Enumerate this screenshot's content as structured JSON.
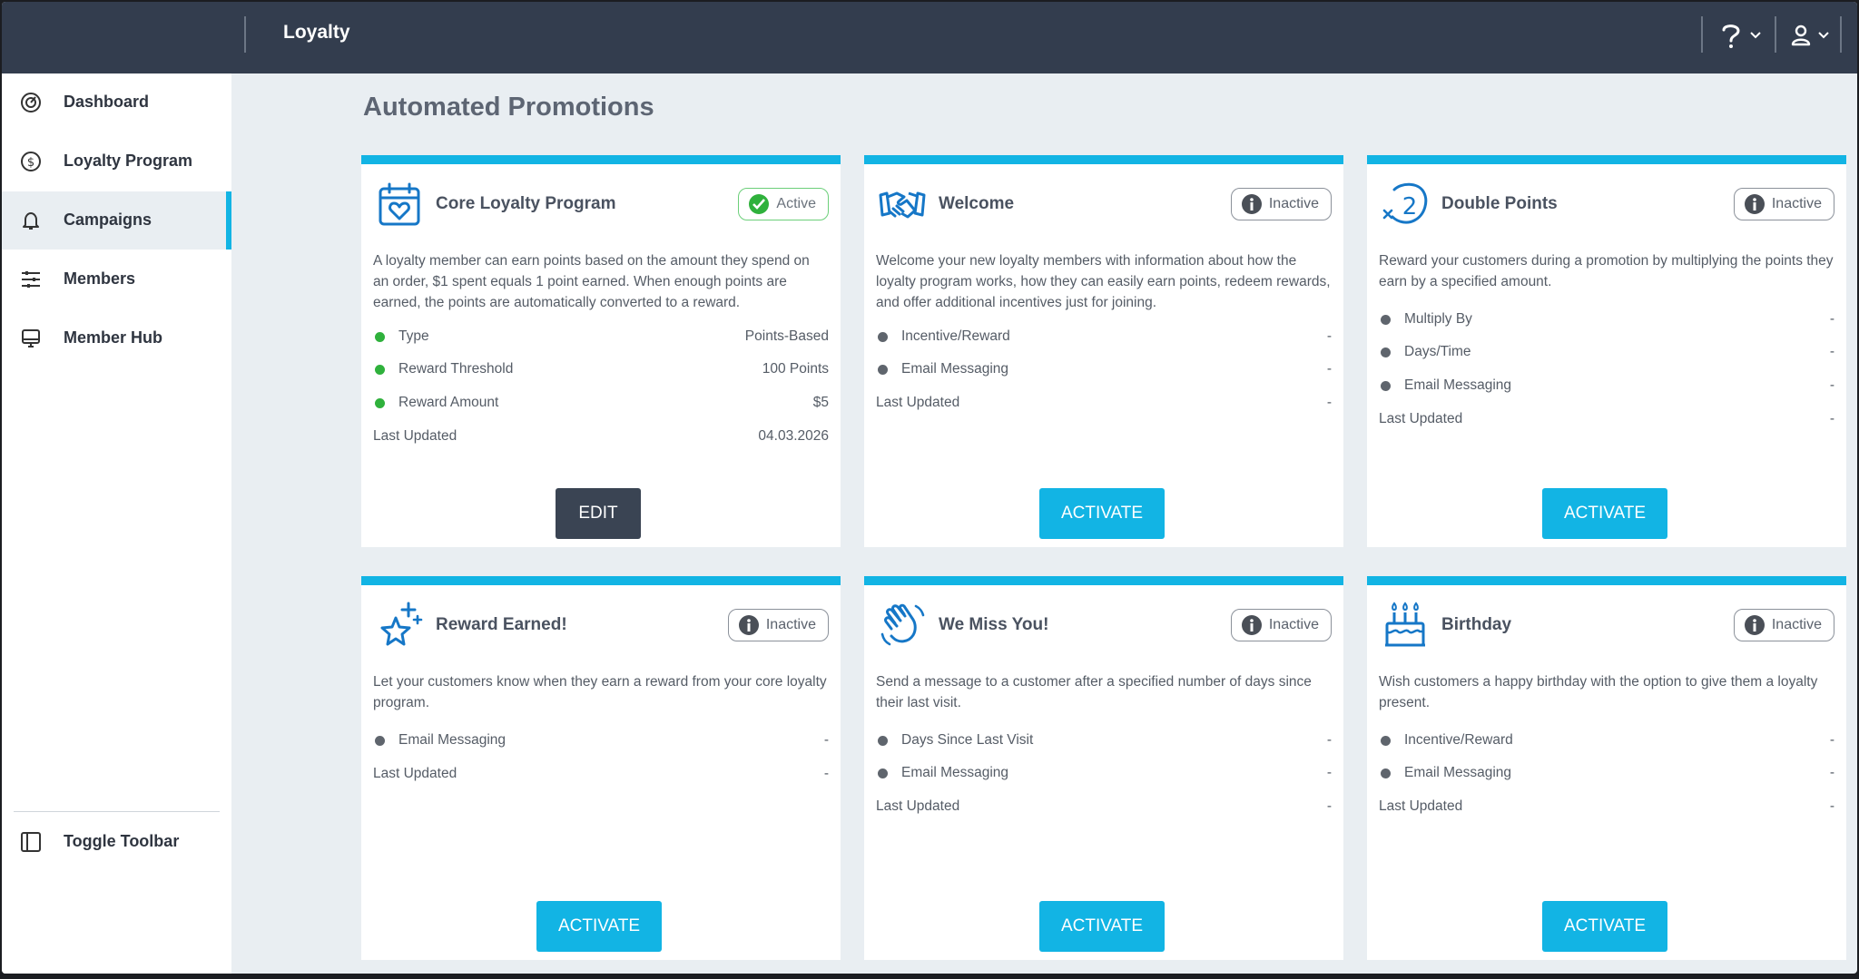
{
  "header": {
    "app_title": "Loyalty"
  },
  "sidebar": {
    "items": [
      {
        "label": "Dashboard",
        "icon": "dashboard-gauge-icon"
      },
      {
        "label": "Loyalty Program",
        "icon": "dollar-circle-icon"
      },
      {
        "label": "Campaigns",
        "icon": "bell-icon",
        "active": true
      },
      {
        "label": "Members",
        "icon": "sliders-icon"
      },
      {
        "label": "Member Hub",
        "icon": "monitor-icon"
      }
    ],
    "toggle_label": "Toggle Toolbar"
  },
  "main": {
    "title": "Automated Promotions",
    "cards": [
      {
        "title": "Core Loyalty Program",
        "icon": "calendar-heart-icon",
        "status": "Active",
        "description": "A loyalty member can earn points based on the amount they spend on an order, $1 spent equals 1 point earned. When enough points are earned, the points are automatically converted to a reward.",
        "rows": [
          {
            "label": "Type",
            "value": "Points-Based"
          },
          {
            "label": "Reward Threshold",
            "value": "100 Points"
          },
          {
            "label": "Reward Amount",
            "value": "$5"
          }
        ],
        "last_updated_label": "Last Updated",
        "last_updated": "04.03.2026",
        "button": "EDIT"
      },
      {
        "title": "Welcome",
        "icon": "handshake-icon",
        "status": "Inactive",
        "description": "Welcome your new loyalty members with information about how the loyalty program works, how they can easily earn points, redeem rewards, and offer additional incentives just for joining.",
        "rows": [
          {
            "label": "Incentive/Reward",
            "value": "-"
          },
          {
            "label": "Email Messaging",
            "value": "-"
          }
        ],
        "last_updated_label": "Last Updated",
        "last_updated": "-",
        "button": "ACTIVATE"
      },
      {
        "title": "Double Points",
        "icon": "times-two-icon",
        "status": "Inactive",
        "description": "Reward your customers during a promotion by multiplying the points they earn by a specified amount.",
        "rows": [
          {
            "label": "Multiply By",
            "value": "-"
          },
          {
            "label": "Days/Time",
            "value": "-"
          },
          {
            "label": "Email Messaging",
            "value": "-"
          }
        ],
        "last_updated_label": "Last Updated",
        "last_updated": "-",
        "button": "ACTIVATE"
      },
      {
        "title": "Reward Earned!",
        "icon": "star-sparkle-icon",
        "status": "Inactive",
        "description": "Let your customers know when they earn a reward from your core loyalty program.",
        "rows": [
          {
            "label": "Email Messaging",
            "value": "-"
          }
        ],
        "last_updated_label": "Last Updated",
        "last_updated": "-",
        "button": "ACTIVATE"
      },
      {
        "title": "We Miss You!",
        "icon": "waving-hand-icon",
        "status": "Inactive",
        "description": "Send a message to a customer after a specified number of days since their last visit.",
        "rows": [
          {
            "label": "Days Since Last Visit",
            "value": "-"
          },
          {
            "label": "Email Messaging",
            "value": "-"
          }
        ],
        "last_updated_label": "Last Updated",
        "last_updated": "-",
        "button": "ACTIVATE"
      },
      {
        "title": "Birthday",
        "icon": "birthday-cake-icon",
        "status": "Inactive",
        "description": "Wish customers a happy birthday with the option to give them a loyalty present.",
        "rows": [
          {
            "label": "Incentive/Reward",
            "value": "-"
          },
          {
            "label": "Email Messaging",
            "value": "-"
          }
        ],
        "last_updated_label": "Last Updated",
        "last_updated": "-",
        "button": "ACTIVATE"
      }
    ]
  },
  "colors": {
    "accent": "#12b4e4",
    "header": "#333d4e",
    "active_status": "#2fb13c",
    "edit_button": "#3a4453"
  }
}
